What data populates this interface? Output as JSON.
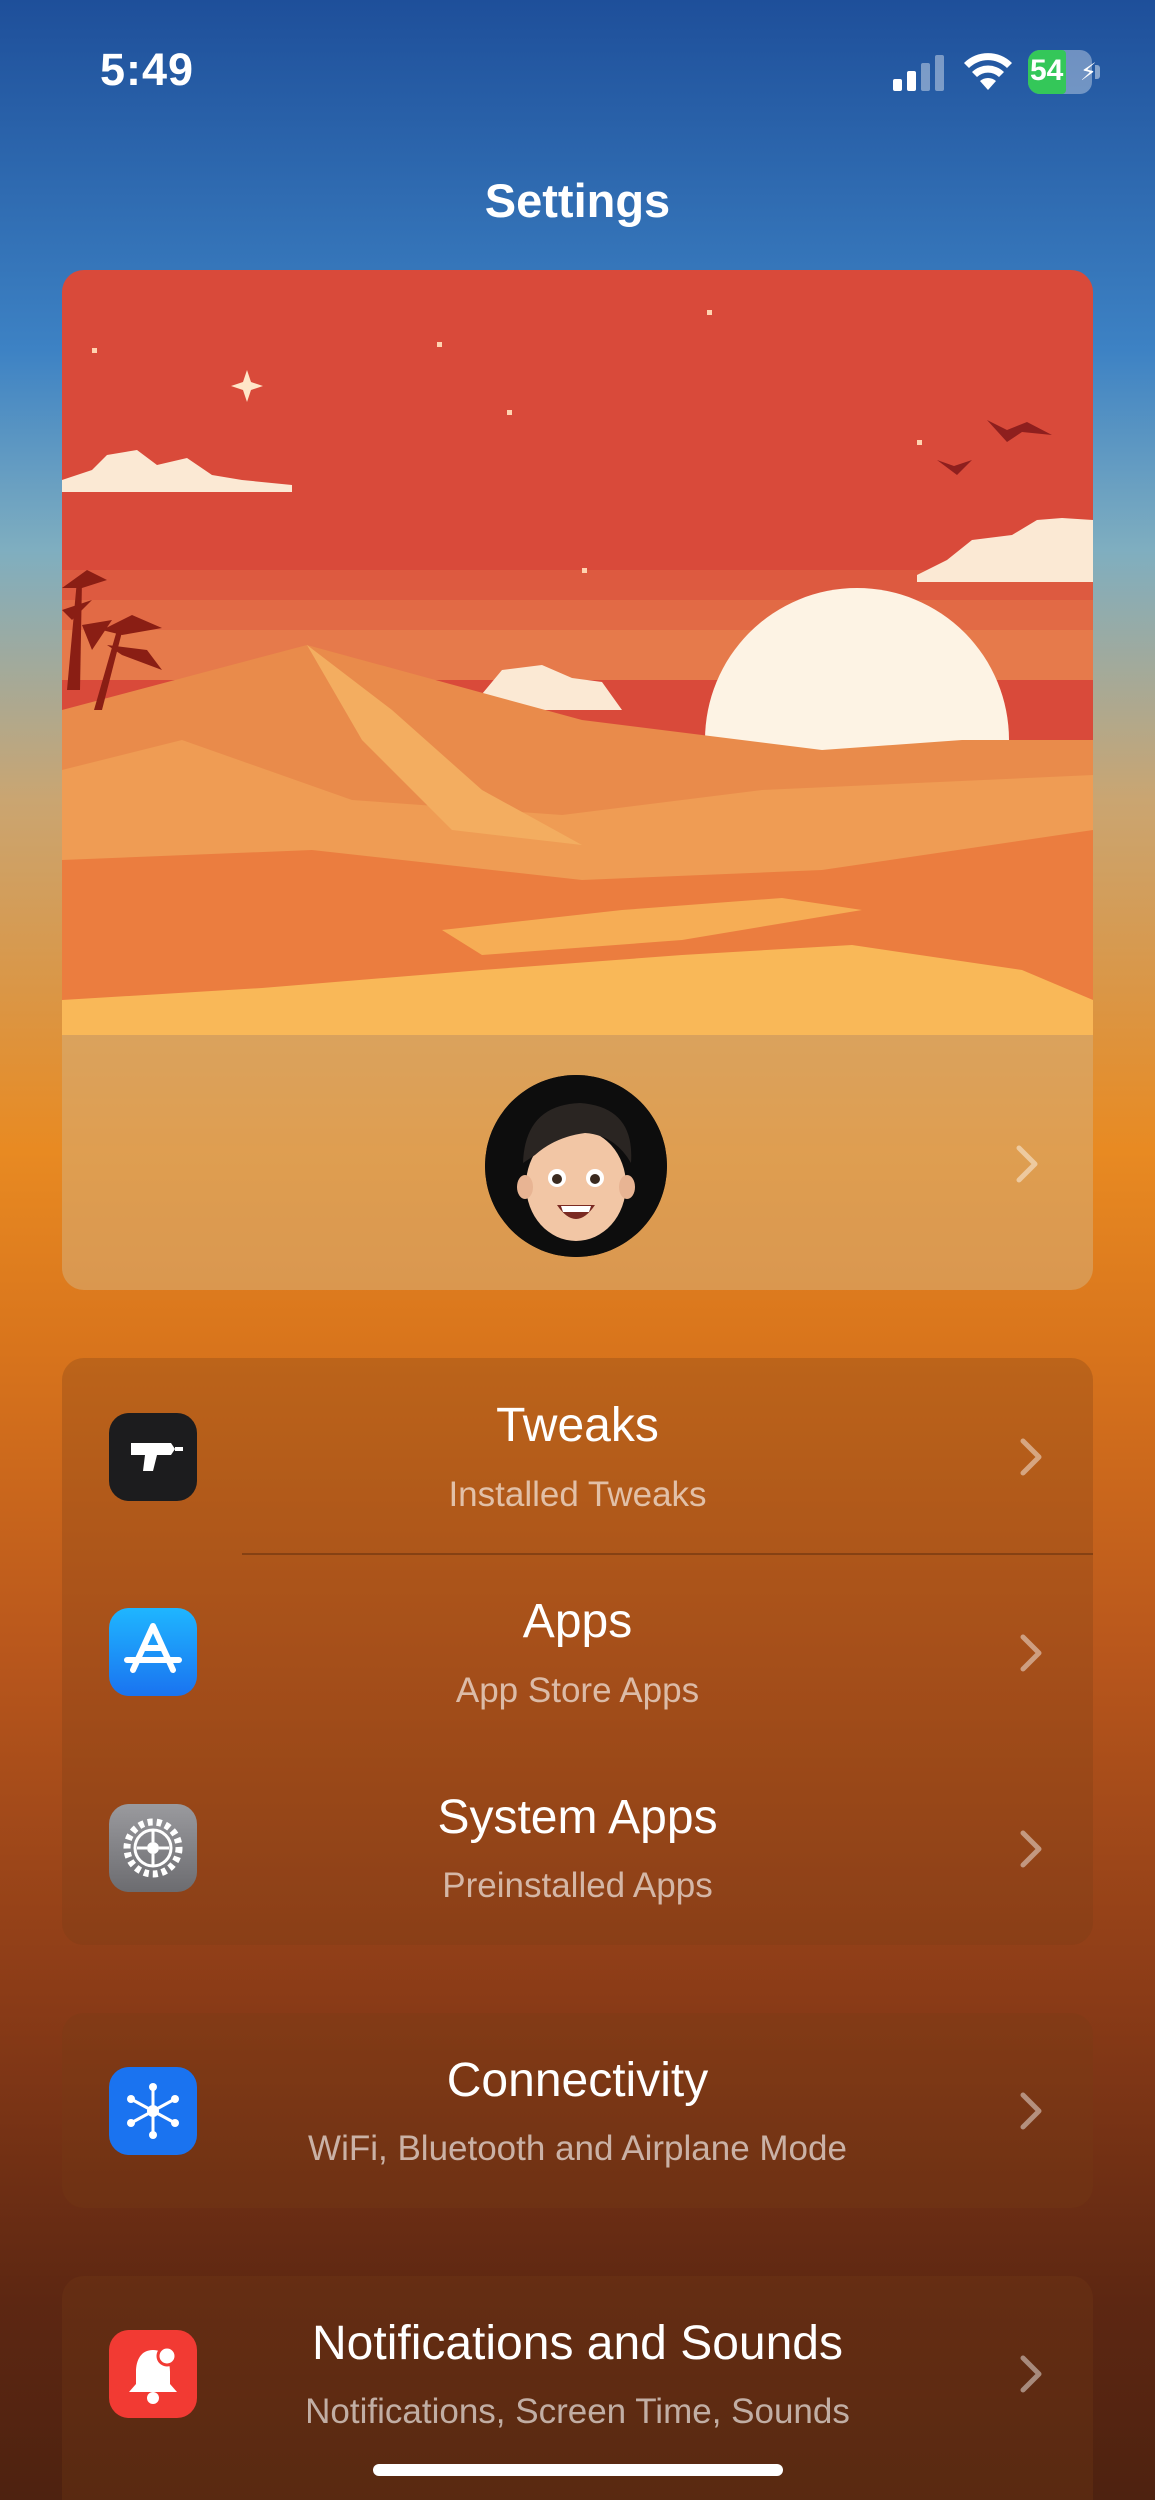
{
  "status_bar": {
    "time": "5:49",
    "battery": "54"
  },
  "page_title": "Settings",
  "menu": [
    {
      "title": "Tweaks",
      "subtitle": "Installed Tweaks",
      "icon": "drill-icon"
    },
    {
      "title": "Apps",
      "subtitle": "App Store Apps",
      "icon": "app-store-icon"
    },
    {
      "title": "System Apps",
      "subtitle": "Preinstalled Apps",
      "icon": "gear-icon"
    },
    {
      "title": "Connectivity",
      "subtitle": "WiFi, Bluetooth and Airplane Mode",
      "icon": "network-hub-icon"
    },
    {
      "title": "Notifications and Sounds",
      "subtitle": "Notifications, Screen Time, Sounds",
      "icon": "bell-icon"
    }
  ],
  "colors": {
    "accent_blue": "#1a73f0",
    "notification_red": "#f23a33",
    "battery_green": "#34c759"
  }
}
